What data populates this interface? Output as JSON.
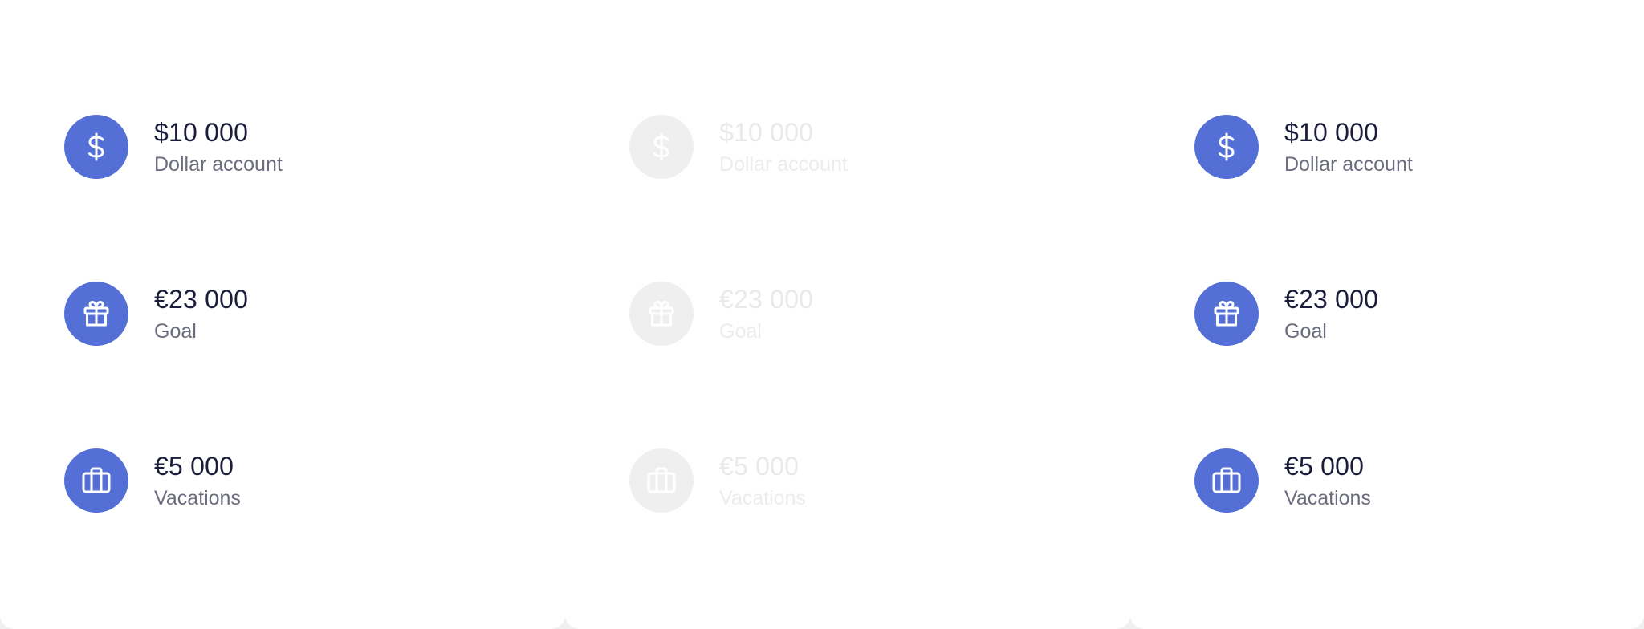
{
  "colors": {
    "accent": "#5470d6",
    "amount_text": "#1b1d3a",
    "label_text": "#6b6d7f",
    "disabled_circle": "#efefef",
    "disabled_text": "#ececef"
  },
  "cards": [
    {
      "state": "default",
      "items": [
        {
          "icon": "dollar-icon",
          "amount": "$10 000",
          "label": "Dollar account"
        },
        {
          "icon": "gift-icon",
          "amount": "€23 000",
          "label": "Goal"
        },
        {
          "icon": "briefcase-icon",
          "amount": "€5 000",
          "label": "Vacations"
        }
      ]
    },
    {
      "state": "disabled",
      "items": [
        {
          "icon": "dollar-icon",
          "amount": "$10 000",
          "label": "Dollar account"
        },
        {
          "icon": "gift-icon",
          "amount": "€23 000",
          "label": "Goal"
        },
        {
          "icon": "briefcase-icon",
          "amount": "€5 000",
          "label": "Vacations"
        }
      ]
    },
    {
      "state": "default",
      "items": [
        {
          "icon": "dollar-icon",
          "amount": "$10 000",
          "label": "Dollar account"
        },
        {
          "icon": "gift-icon",
          "amount": "€23 000",
          "label": "Goal"
        },
        {
          "icon": "briefcase-icon",
          "amount": "€5 000",
          "label": "Vacations"
        }
      ]
    }
  ]
}
